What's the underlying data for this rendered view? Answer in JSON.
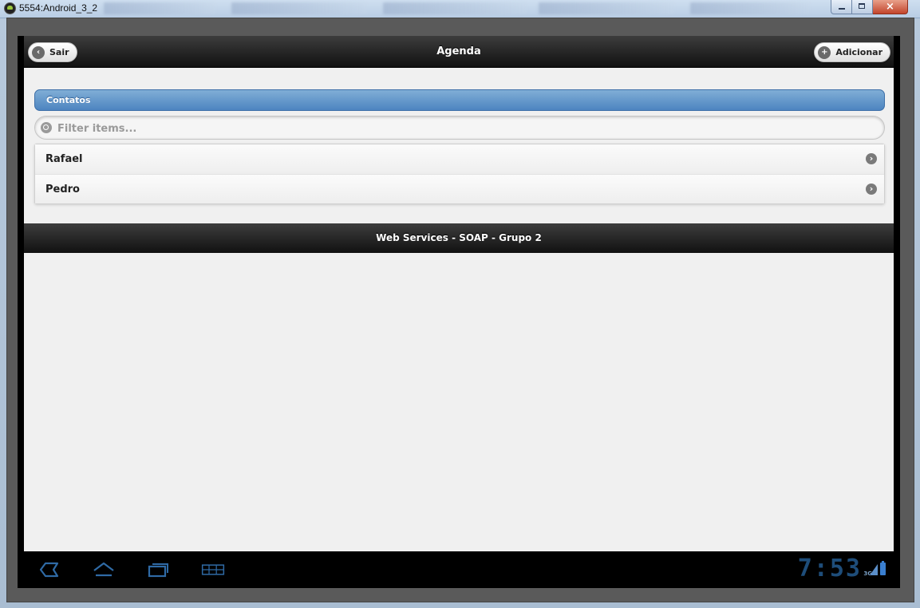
{
  "window": {
    "title": "5554:Android_3_2",
    "close_glyph": "×"
  },
  "app": {
    "header": {
      "title": "Agenda",
      "left_button_label": "Sair",
      "right_button_label": "Adicionar",
      "left_icon": "arrow-left-icon",
      "right_icon": "plus-icon"
    },
    "list": {
      "divider_label": "Contatos",
      "filter_placeholder": "Filter items...",
      "items": [
        {
          "label": "Rafael",
          "icon": "chevron-right-icon"
        },
        {
          "label": "Pedro",
          "icon": "chevron-right-icon"
        }
      ]
    },
    "footer": {
      "title": "Web Services - SOAP - Grupo 2"
    }
  },
  "system_bar": {
    "clock": "7:53",
    "network": "3G"
  },
  "colors": {
    "divider": "#4d84c0",
    "header": "#1a1a1a",
    "clock": "#1e4d7a"
  }
}
